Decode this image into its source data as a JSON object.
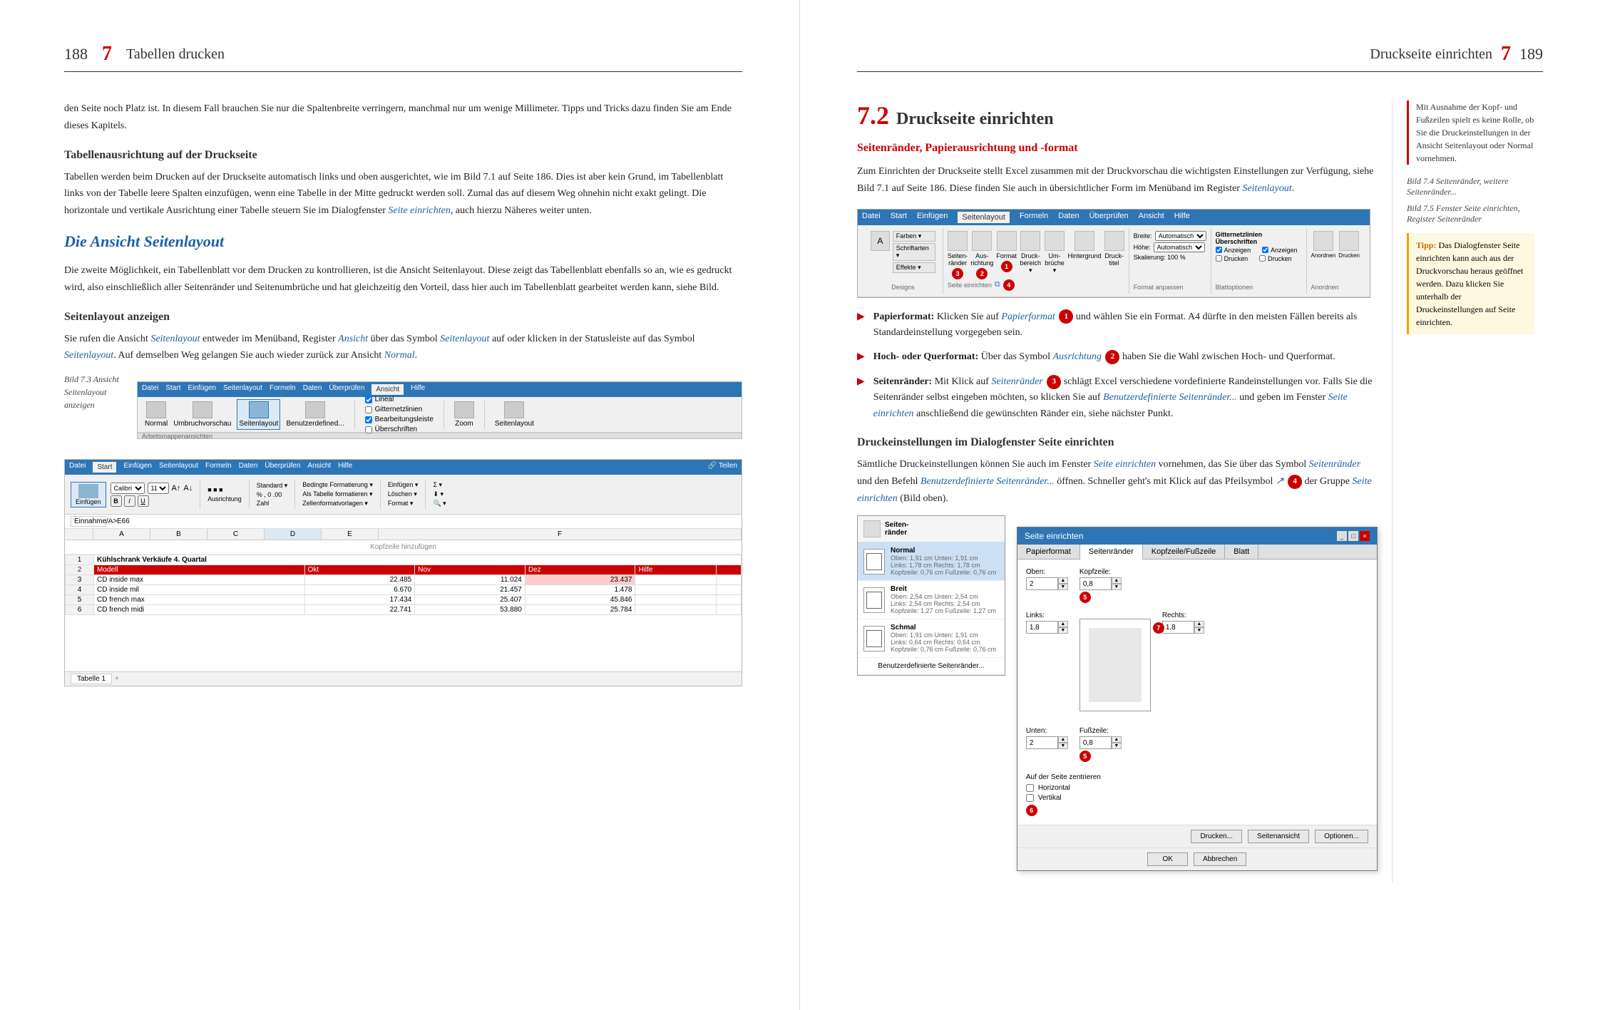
{
  "left_page": {
    "page_number": "188",
    "chapter_number": "7",
    "chapter_title": "Tabellen drucken",
    "body_paragraphs": [
      "den Seite noch Platz ist. In diesem Fall brauchen Sie nur die Spaltenbreite verringern, manchmal nur um wenige Millimeter. Tipps und Tricks dazu finden Sie am Ende dieses Kapitels.",
      "Tabellen werden beim Drucken auf der Druckseite automatisch links und oben ausgerichtet, wie im Bild 7.1 auf Seite 186. Dies ist aber kein Grund, im Tabellenblatt links von der Tabelle leere Spalten einzufügen, wenn eine Tabelle in der Mitte gedruckt werden soll. Zumal das auf diesem Weg ohnehin nicht exakt gelingt. Die horizontale und vertikale Ausrichtung einer Tabelle steuern Sie im Dialogfenster Seite einrichten, auch hierzu Näheres weiter unten.",
      "Die zweite Möglichkeit, ein Tabellenblatt vor dem Drucken zu kontrollieren, ist die Ansicht Seitenlayout. Diese zeigt das Tabellenblatt ebenfalls so an, wie es gedruckt wird, also einschließlich aller Seitenränder und Seitenumbrüche und hat gleichzeitig den Vorteil, dass hier auch im Tabellenblatt gearbeitet werden kann, siehe Bild.",
      "Sie rufen die Ansicht Seitenlayout entweder im Menüband, Register Ansicht über das Symbol Seitenlayout auf oder klicken in der Statusleiste auf das Symbol Seitenlayout. Auf demselben Weg gelangen Sie auch wieder zurück zur Ansicht Normal."
    ],
    "section_tabellenausrichtung": "Tabellenausrichtung auf der Druckseite",
    "section_ansicht": "Die Ansicht Seitenlayout",
    "subsection_anzeigen": "Seitenlayout anzeigen",
    "caption_fig73": "Bild 7.3 Ansicht Seitenlayout anzeigen",
    "menu_items_1": [
      "Datei",
      "Start",
      "Einfügen",
      "Seitenlayout",
      "Formeln",
      "Daten",
      "Überprüfen",
      "Ansicht",
      "Hilfe"
    ],
    "menu_items_2": [
      "Datei",
      "Start",
      "Einfügen",
      "Seitenlayout",
      "Formeln",
      "Daten",
      "Überprüfen",
      "Ansicht",
      "Hilfe",
      "Teilen"
    ]
  },
  "right_page": {
    "page_number": "189",
    "chapter_number": "7",
    "chapter_title": "Druckseite einrichten",
    "section_number": "7.2",
    "section_title": "Druckseite einrichten",
    "subsection1": "Seitenränder, Papierausrichtung und -format",
    "body1": "Zum Einrichten der Druckseite stellt Excel zusammen mit der Druckvorschau die wichtigsten Einstellungen zur Verfügung, siehe Bild 7.1 auf Seite 186. Diese finden Sie auch in übersichtlicher Form im Menüband im Register Seitenlayout.",
    "bullet_items": [
      {
        "label": "Papierformat:",
        "text": "Klicken Sie auf Papierformat ① und wählen Sie ein Format. A4 dürfte in den meisten Fällen bereits als Standardeinstellung vorgegeben sein."
      },
      {
        "label": "Hoch- oder Querformat:",
        "text": "Über das Symbol Ausrichtung ② haben Sie die Wahl zwischen Hoch- und Querformat."
      },
      {
        "label": "Seitenränder:",
        "text": "Mit Klick auf Seitenränder ③ schlägt Excel verschiedene vordefinierte Randeinstellungen vor. Falls Sie die Seitenränder selbst eingeben möchten, so klicken Sie auf Benutzerdefinierte Seitenränder... und geben im Fenster Seite einrichten anschließend die gewünschten Ränder ein, siehe nächster Punkt."
      }
    ],
    "subsection2": "Druckeinstellungen im Dialogfenster Seite einrichten",
    "body2": "Sämtliche Druckeinstellungen können Sie auch im Fenster Seite einrichten vornehmen, das Sie über das Symbol Seitenränder und den Befehl Benutzerdefinierte Seitenränder... öffnen. Schneller geht's mit Klick auf das Pfeilsymbol ④ der Gruppe Seite einrichten (Bild oben).",
    "caption_fig74": "Bild 7.4 Seitenränder, weitere Seitenränder...",
    "caption_fig75": "Bild 7.5 Fenster Seite einrichten, Register Seitenränder",
    "sidebar_note": "Mit Ausnahme der Kopf- und Fußzeilen spielt es keine Rolle, ob Sie die Druckeinstellungen in der Ansicht Seitenlayout oder Normal vornehmen.",
    "tipp": "Das Dialogfenster Seite einrichten kann auch aus der Druckvorschau heraus geöffnet werden. Dazu klicken Sie unterhalb der Druckeinstellungen auf Seite einrichten.",
    "dialog": {
      "title": "Seite einrichten",
      "close": "×",
      "tabs": [
        "Papierformat",
        "Seitenränder",
        "Kopfzeile/Fußzeile",
        "Blatt"
      ],
      "margin_options": [
        {
          "label": "Normal",
          "oben": "1,91 cm",
          "unten": "1,91 cm",
          "links": "1,78 cm",
          "rechts": "1,78 cm",
          "kopfzeile": "0,76 cm",
          "fußzeile": "0,76 cm"
        },
        {
          "label": "Breit",
          "oben": "2,54 cm",
          "unten": "2,54 cm",
          "links": "2,54 cm",
          "rechts": "2,54 cm",
          "kopfzeile": "1,27 cm",
          "fußzeile": "1,27 cm"
        },
        {
          "label": "Schmal",
          "oben": "1,91 cm",
          "unten": "1,91 cm",
          "links": "0,64 cm",
          "rechts": "0,64 cm",
          "kopfzeile": "0,76 cm",
          "fußzeile": "0,76 cm"
        },
        {
          "label": "Benutzerdefinierte Seitenränder"
        }
      ],
      "right_fields": {
        "oben_label": "Oben:",
        "oben_value": "2",
        "rechts_label": "Rechts:",
        "rechts_value": "1,8",
        "links_label": "Links:",
        "links_value": "1,8",
        "unten_label": "Unten:",
        "unten_value": "2",
        "kopfzeile_label": "Kopfzeile:",
        "kopfzeile_value": "0,8",
        "fußzeile_label": "Fußzeile:",
        "fußzeile_value": "0,8"
      },
      "center_label": "Auf der Seite zentrieren",
      "horizontal_label": "Horizontal",
      "vertical_label": "Vertikal",
      "buttons": [
        "Drucken...",
        "Seitenansicht",
        "Optionen..."
      ],
      "ok_label": "OK",
      "cancel_label": "Abbrechen"
    },
    "ribbon": {
      "tabs": [
        "Datei",
        "Start",
        "Einfügen",
        "Seitenlayout",
        "Formeln",
        "Daten",
        "Überprüfen",
        "Ansicht",
        "Hilfe"
      ],
      "active_tab": "Seitenlayout",
      "groups": {
        "designs": "Designs",
        "seite_einrichten": "Seite einrichten",
        "format_anpassen": "Format anpassen",
        "blattoptionen": "Blattoptionen",
        "anordnen": "Anordnen"
      }
    }
  }
}
